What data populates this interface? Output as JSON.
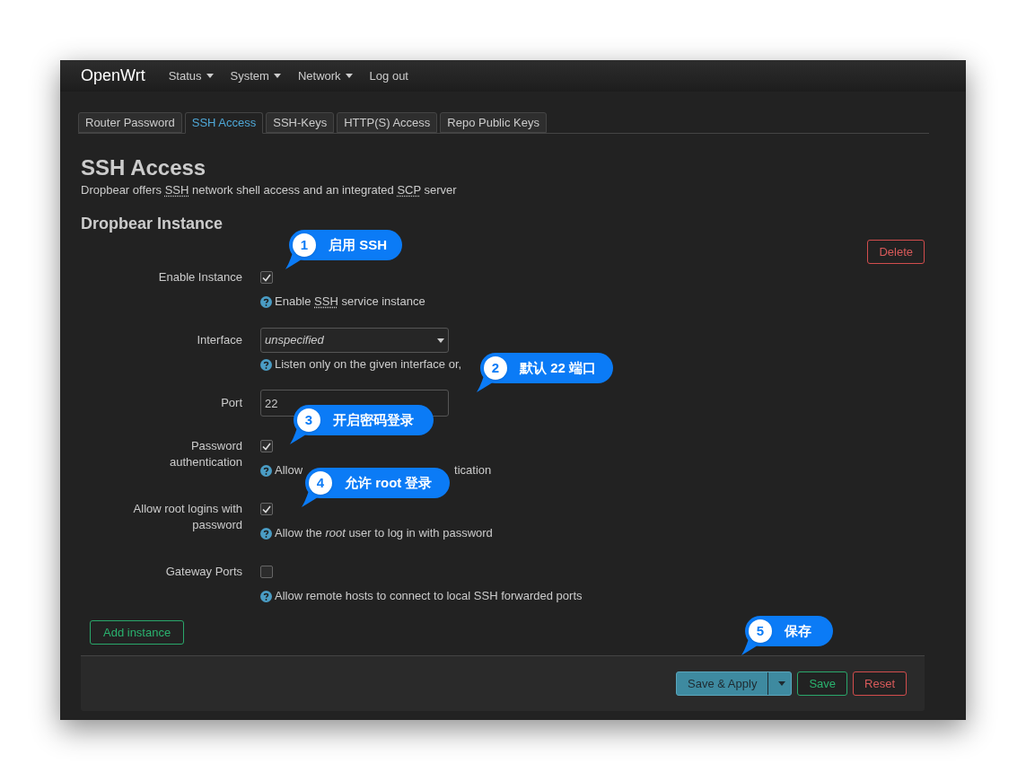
{
  "brand": "OpenWrt",
  "nav": [
    {
      "label": "Status",
      "dropdown": true
    },
    {
      "label": "System",
      "dropdown": true
    },
    {
      "label": "Network",
      "dropdown": true
    },
    {
      "label": "Log out",
      "dropdown": false
    }
  ],
  "tabs": [
    {
      "label": "Router Password",
      "selected": false
    },
    {
      "label": "SSH Access",
      "selected": true
    },
    {
      "label": "SSH-Keys",
      "selected": false
    },
    {
      "label": "HTTP(S) Access",
      "selected": false
    },
    {
      "label": "Repo Public Keys",
      "selected": false
    }
  ],
  "page": {
    "title": "SSH Access",
    "description": [
      {
        "text": "Dropbear offers ",
        "abbr": false
      },
      {
        "text": "SSH",
        "abbr": true
      },
      {
        "text": " network shell access and an integrated ",
        "abbr": false
      },
      {
        "text": "SCP",
        "abbr": true
      },
      {
        "text": " server",
        "abbr": false
      }
    ]
  },
  "section": {
    "title": "Dropbear Instance",
    "delete_button": "Delete"
  },
  "fields": [
    {
      "label": "Enable Instance",
      "kind": "checkbox",
      "checked": true,
      "help": [
        [
          {
            "text": "Enable ",
            "abbr": false
          },
          {
            "text": "SSH",
            "abbr": true
          },
          {
            "text": " service instance",
            "abbr": false
          }
        ]
      ]
    },
    {
      "label": "Interface",
      "kind": "select",
      "value": "unspecified",
      "help": [
        [
          {
            "text": "Listen only on the given interface or,",
            "abbr": false
          }
        ]
      ]
    },
    {
      "label": "Port",
      "kind": "text",
      "value": "22"
    },
    {
      "label": "Password authentication",
      "kind": "checkbox",
      "checked": true,
      "help": [
        [
          {
            "text": "Allow",
            "abbr": false
          }
        ],
        [
          {
            "text": "tication",
            "abbr": false
          }
        ]
      ]
    },
    {
      "label": "Allow root logins with password",
      "kind": "checkbox",
      "checked": true,
      "help": [
        [
          {
            "text": "Allow the *root* user to log in with password",
            "abbr": false
          }
        ]
      ]
    },
    {
      "label": "Gateway Ports",
      "kind": "checkbox",
      "checked": false,
      "help": [
        [
          {
            "text": "Allow remote hosts to connect to local SSH forwarded ports",
            "abbr": false
          }
        ]
      ]
    }
  ],
  "add_button": "Add instance",
  "actions": [
    {
      "label": "Save & Apply",
      "kind": "apply"
    },
    {
      "label": "Save",
      "kind": "save"
    },
    {
      "label": "Reset",
      "kind": "reset"
    }
  ],
  "callouts": [
    {
      "number": "1",
      "text": "启用 SSH"
    },
    {
      "number": "2",
      "text": "默认 22 端口"
    },
    {
      "number": "3",
      "text": "开启密码登录"
    },
    {
      "number": "4",
      "text": "允许 root 登录"
    },
    {
      "number": "5",
      "text": "保存"
    }
  ]
}
